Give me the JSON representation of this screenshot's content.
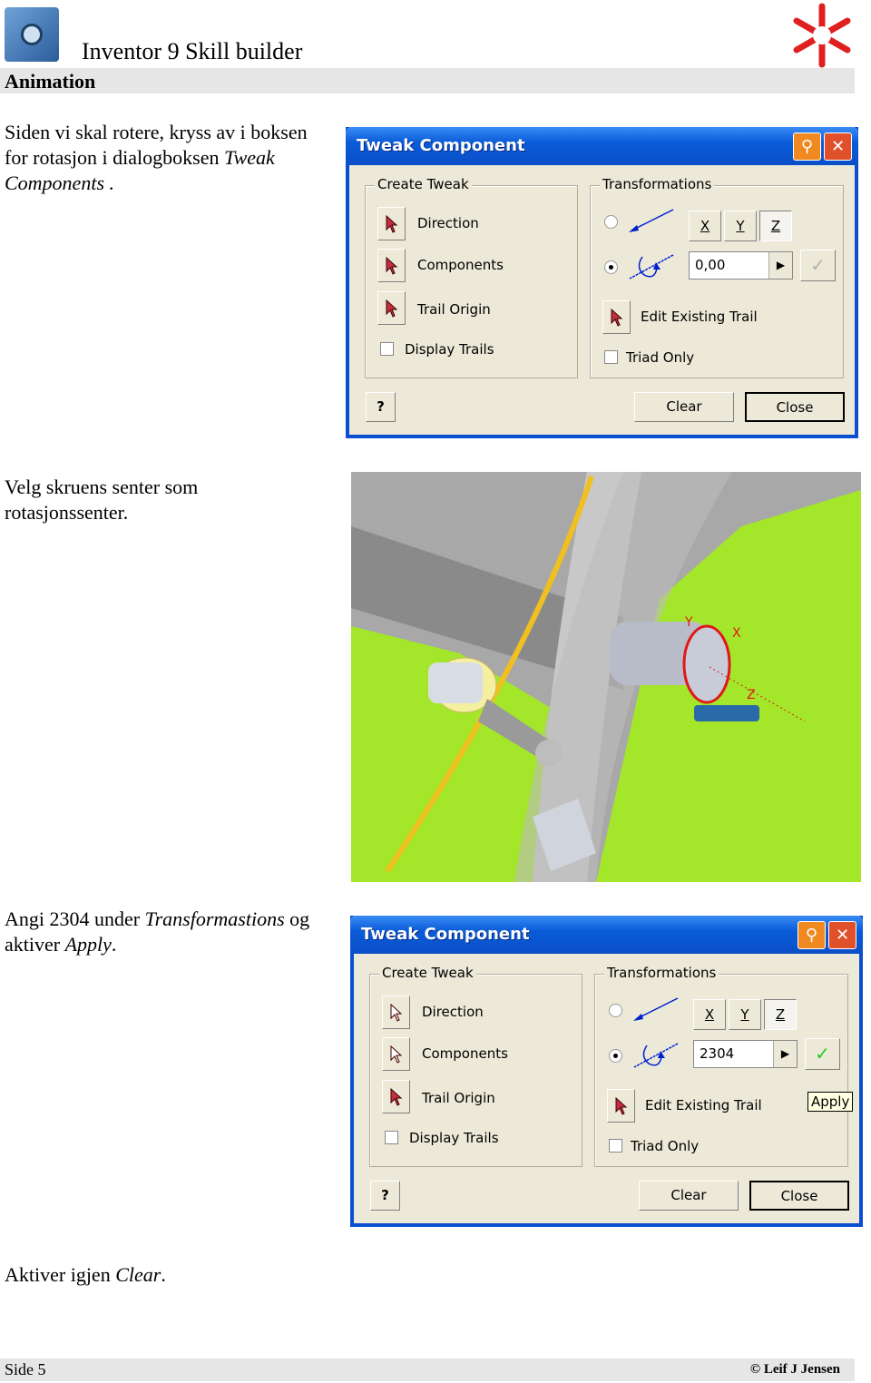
{
  "header": {
    "title": "Inventor 9  Skill builder",
    "section": "Animation"
  },
  "steps": [
    {
      "text_plain": "Siden vi skal rotere, kryss av i boksen for rotasjon i dialogboksen ",
      "text_italic": "Tweak Components .",
      "text_after": ""
    },
    {
      "text_plain": "Velg skruens senter som rotasjonssenter.",
      "text_italic": "",
      "text_after": ""
    },
    {
      "text_plain": "Angi 2304 under ",
      "text_italic": "Transformastions",
      "text_after": " og aktiver ",
      "text_italic2": "Apply",
      "text_after2": "."
    },
    {
      "text_plain": "Aktiver igjen ",
      "text_italic": "Clear",
      "text_after": "."
    }
  ],
  "dialogs": [
    {
      "title": "Tweak Component",
      "create_tweak": "Create Tweak",
      "direction": "Direction",
      "components": "Components",
      "trail_origin": "Trail Origin",
      "display_trails": "Display Trails",
      "transformations": "Transformations",
      "x": "X",
      "y": "Y",
      "z": "Z",
      "value": "0,00",
      "edit_trail": "Edit Existing Trail",
      "triad_only": "Triad Only",
      "clear": "Clear",
      "close": "Close",
      "help": "?",
      "selected_axis": "Z",
      "rotation_selected": true,
      "apply_enabled": false
    },
    {
      "title": "Tweak Component",
      "create_tweak": "Create Tweak",
      "direction": "Direction",
      "components": "Components",
      "trail_origin": "Trail Origin",
      "display_trails": "Display Trails",
      "transformations": "Transformations",
      "x": "X",
      "y": "Y",
      "z": "Z",
      "value": "2304",
      "edit_trail": "Edit Existing Trail",
      "triad_only": "Triad Only",
      "clear": "Clear",
      "close": "Close",
      "help": "?",
      "tooltip": "Apply",
      "selected_axis": "Z",
      "rotation_selected": true,
      "apply_enabled": true
    }
  ],
  "viewport": {
    "triad_labels": [
      "Y",
      "X",
      "Z"
    ]
  },
  "footer": {
    "page": "Side 5",
    "copyright": "© Leif J Jensen"
  },
  "colors": {
    "titlebar": "#0a5bd8",
    "dialog_bg": "#ece9d8",
    "apply_check": "#22cc22",
    "cad_green": "#a4e62a"
  }
}
